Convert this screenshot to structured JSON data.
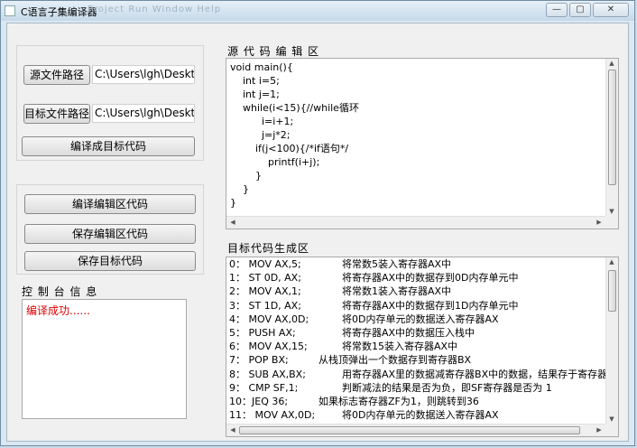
{
  "window": {
    "title": "C语言子集编译器",
    "ghost_menu": "Project   Run   Window   Help",
    "minimize": "—",
    "maximize": "▢",
    "close": "✕"
  },
  "left_panel": {
    "source_path_button": "源文件路径",
    "source_path_value": "C:\\Users\\lgh\\Desktop",
    "target_path_button": "目标文件路径",
    "target_path_value": "C:\\Users\\lgh\\Desktop",
    "compile_to_target_button": "编译成目标代码",
    "compile_editor_button": "编译编辑区代码",
    "save_editor_button": "保存编辑区代码",
    "save_target_button": "保存目标代码",
    "console_title": "控 制 台 信 息",
    "console_message": "编译成功......"
  },
  "source_editor": {
    "title": "源 代 码 编 辑 区",
    "code": "void main(){\n    int i=5;\n    int j=1;\n    while(i<15){//while循环\n          i=i+1;\n          j=j*2;\n        if(j<100){/*if语句*/\n            printf(i+j);\n        }\n    }\n}"
  },
  "target_output": {
    "title": "目标代码生成区",
    "rows": [
      {
        "code": "0：  MOV AX,5;",
        "comment": "将常数5装入寄存器AX中"
      },
      {
        "code": "1：  ST 0D, AX;",
        "comment": "将寄存器AX中的数据存到0D内存单元中"
      },
      {
        "code": "2：  MOV AX,1;",
        "comment": "将常数1装入寄存器AX中"
      },
      {
        "code": "3：  ST 1D, AX;",
        "comment": "将寄存器AX中的数据存到1D内存单元中"
      },
      {
        "code": "4：  MOV AX,0D;",
        "comment": "将0D内存单元的数据送入寄存器AX"
      },
      {
        "code": "5：  PUSH AX;",
        "comment": "将寄存器AX中的数据压入栈中"
      },
      {
        "code": "6：  MOV AX,15;",
        "comment": "将常数15装入寄存器AX中"
      },
      {
        "code": "7：  POP BX;",
        "comment": "从栈顶弹出一个数据存到寄存器BX"
      },
      {
        "code": "8：  SUB AX,BX;",
        "comment": "用寄存器AX里的数据减寄存器BX中的数据，结果存于寄存器AX"
      },
      {
        "code": "9：  CMP SF,1;",
        "comment": "判断减法的结果是否为负，即SF寄存器是否为 1"
      },
      {
        "code": "10：JEQ 36;",
        "comment": "如果标志寄存器ZF为1，则跳转到36"
      },
      {
        "code": "11：  MOV AX,0D;",
        "comment": "将0D内存单元的数据送入寄存器AX"
      }
    ]
  }
}
